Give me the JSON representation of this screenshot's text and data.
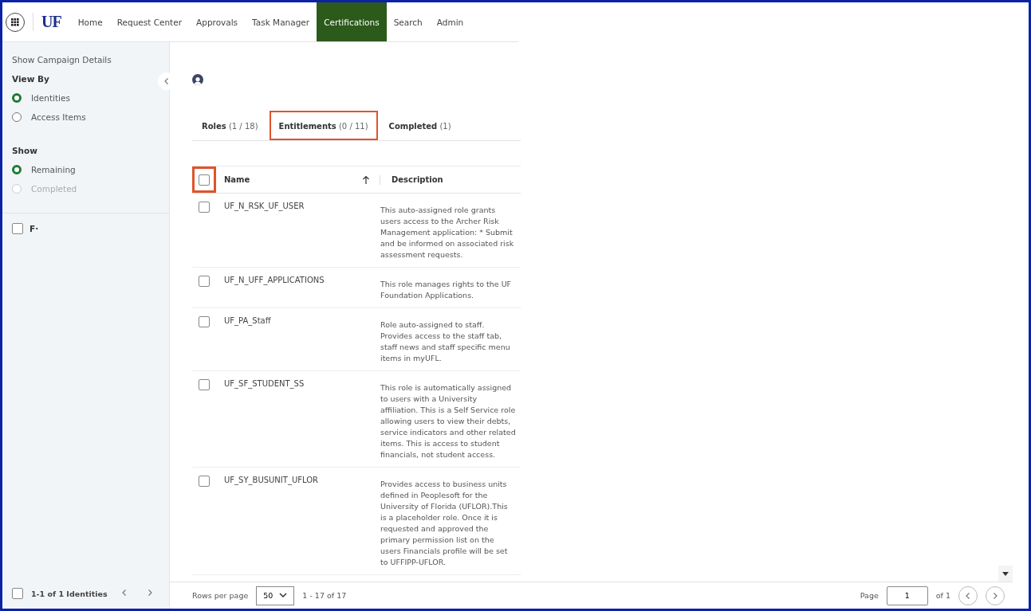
{
  "nav": {
    "logo": "UF",
    "items": [
      {
        "label": "Home",
        "selected": false
      },
      {
        "label": "Request Center",
        "selected": false
      },
      {
        "label": "Approvals",
        "selected": false
      },
      {
        "label": "Task Manager",
        "selected": false
      },
      {
        "label": "Certifications",
        "selected": true
      },
      {
        "label": "Search",
        "selected": false
      },
      {
        "label": "Admin",
        "selected": false
      }
    ]
  },
  "sidebar": {
    "details_link": "Show Campaign Details",
    "groups": [
      {
        "title": "View By",
        "options": [
          {
            "label": "Identities",
            "selected": true,
            "disabled": false
          },
          {
            "label": "Access Items",
            "selected": false,
            "disabled": false
          }
        ]
      },
      {
        "title": "Show",
        "options": [
          {
            "label": "Remaining",
            "selected": true,
            "disabled": false
          },
          {
            "label": "Completed",
            "selected": false,
            "disabled": true
          }
        ]
      }
    ],
    "identities": [
      {
        "label": "F·",
        "checked": false
      }
    ],
    "footer": {
      "checked": false,
      "count": "1-1 of 1 Identities"
    }
  },
  "tabs": [
    {
      "label": "Roles",
      "count": "(1 / 18)",
      "selected": false,
      "highlighted": false
    },
    {
      "label": "Entitlements",
      "count": "(0 / 11)",
      "selected": false,
      "highlighted": true
    },
    {
      "label": "Completed",
      "count": "(1)",
      "selected": false,
      "highlighted": false
    }
  ],
  "table": {
    "select_all": {
      "checked": false,
      "highlighted": true
    },
    "columns": [
      "Name",
      "Description"
    ],
    "rows": [
      {
        "checked": false,
        "name": "UF_N_RSK_UF_USER",
        "description": "This auto-assigned role grants users access to the Archer Risk Management application: * Submit and be informed on associated risk assessment requests."
      },
      {
        "checked": false,
        "name": "UF_N_UFF_APPLICATIONS",
        "description": "This role manages rights to the UF Foundation Applications."
      },
      {
        "checked": false,
        "name": "UF_PA_Staff",
        "description": "Role auto-assigned to staff. Provides access to the staff tab, staff news and staff specific menu items in myUFL."
      },
      {
        "checked": false,
        "name": "UF_SF_STUDENT_SS",
        "description": "This role is automatically assigned to users with a University affiliation. This is a Self Service role allowing users to view their debts, service indicators and other related items. This is access to student financials, not student access."
      },
      {
        "checked": false,
        "name": "UF_SY_BUSUNIT_UFLOR",
        "description": "Provides access to business units defined in Peoplesoft for the University of Florida (UFLOR).This is a placeholder role. Once it is requested and approved the primary permission list on the users Financials profile will be set to UFFIPP-UFLOR."
      }
    ]
  },
  "pagination": {
    "rows_label": "Rows per page",
    "rows_value": "50",
    "range": "1 - 17 of 17",
    "page_label": "Page",
    "page_value": "1",
    "page_total": "of 1"
  }
}
